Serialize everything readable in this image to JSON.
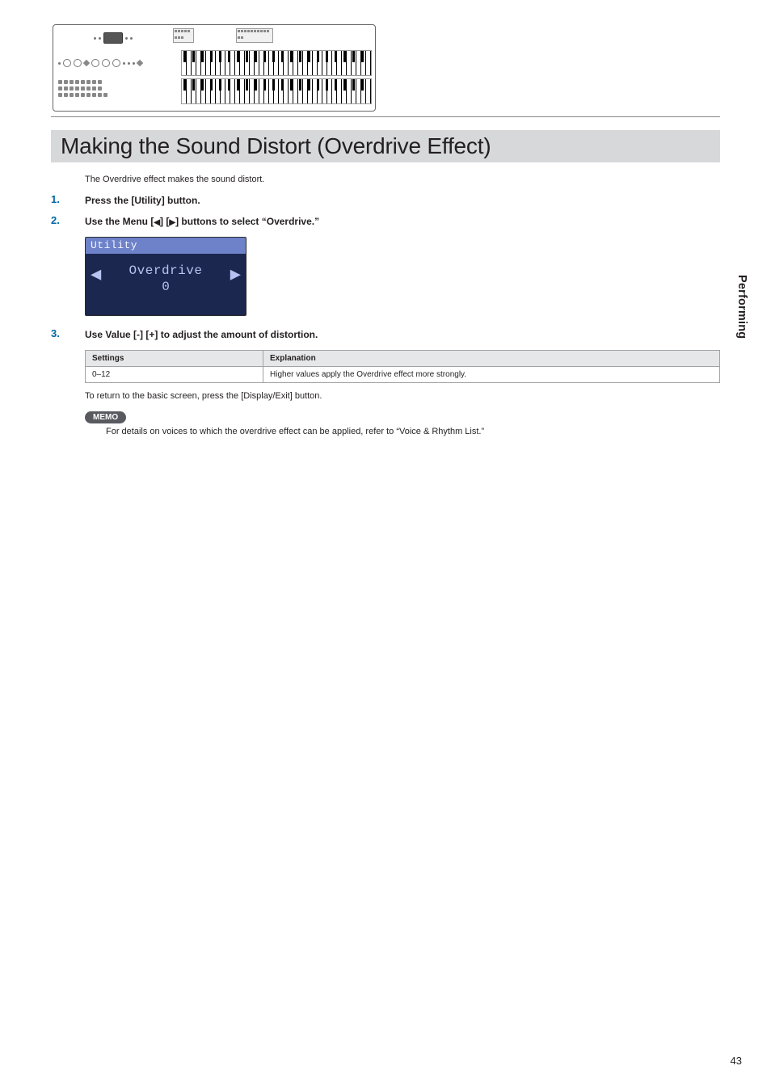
{
  "heading": "Making the Sound Distort (Overdrive Effect)",
  "intro": "The Overdrive effect makes the sound distort.",
  "steps": [
    {
      "num": "1",
      "text": "Press the [Utility] button."
    },
    {
      "num": "2",
      "text_prefix": "Use the Menu [",
      "text_mid": "] [",
      "text_suffix": "] buttons to select “Overdrive.”"
    },
    {
      "num": "3",
      "text": "Use Value [-] [+] to adjust the amount of distortion."
    }
  ],
  "lcd": {
    "title": "Utility",
    "param_name": "Overdrive",
    "param_value": "0",
    "arrow_left": "◀",
    "arrow_right": "▶"
  },
  "step2_arrows": {
    "left": "◀",
    "right": "▶"
  },
  "table": {
    "headers": [
      "Settings",
      "Explanation"
    ],
    "rows": [
      {
        "setting": "0–12",
        "explain": "Higher values apply the Overdrive effect more strongly."
      }
    ]
  },
  "after_table_note": "To return to the basic screen, press the [Display/Exit] button.",
  "memo_label": "MEMO",
  "memo_text": "For details on voices to which the overdrive effect can be applied, refer to “Voice & Rhythm List.”",
  "side_tab": "Performing",
  "page_number": "43"
}
